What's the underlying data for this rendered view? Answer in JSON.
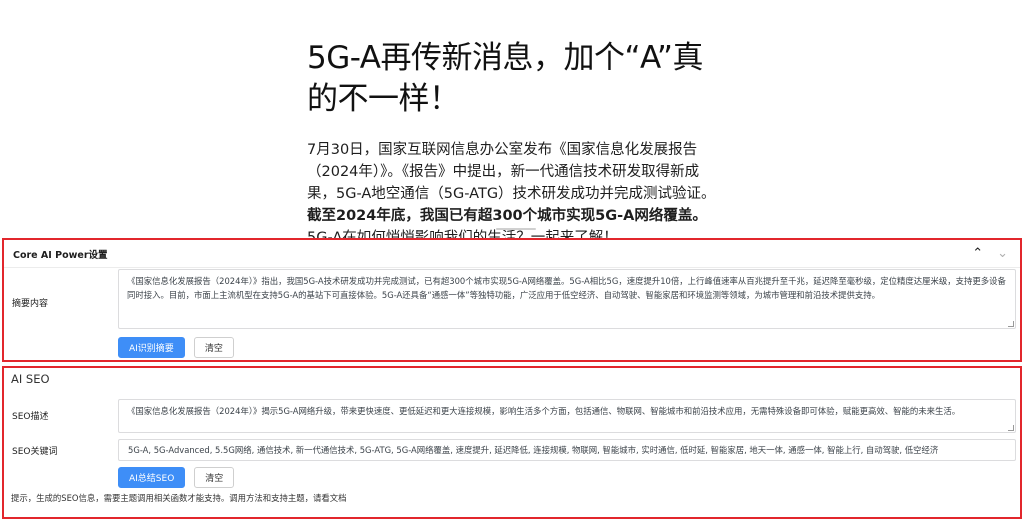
{
  "article": {
    "title": "5G-A再传新消息，加个“A”真的不一样！",
    "lead_normal": "7月30日，国家互联网信息办公室发布《国家信息化发展报告（2024年）》。《报告》中提出，新一代通信技术研发取得新成果，5G-A地空通信（5G-ATG）技术研发成功并完成测试验证。",
    "lead_bold": "截至2024年底，我国已有超300个城市实现5G-A网络覆盖。",
    "lead_tail": "5G-A在如何悄悄影响我们的生活？一起来了解！"
  },
  "core_panel": {
    "title": "Core AI Power设置",
    "summary_label": "摘要内容",
    "summary_text": "《国家信息化发展报告（2024年）》指出，我国5G-A技术研发成功并完成测试，已有超300个城市实现5G-A网络覆盖。5G-A相比5G，速度提升10倍，上行峰值速率从百兆提升至千兆，延迟降至毫秒级，定位精度达厘米级，支持更多设备同时接入。目前，市面上主流机型在支持5G-A的基站下可直接体验。5G-A还具备“通感一体”等独特功能，广泛应用于低空经济、自动驾驶、智能家居和环境监测等领域，为城市管理和前沿技术提供支持。",
    "ai_button": "AI识别摘要",
    "clear_button": "清空"
  },
  "seo_panel": {
    "title": "AI SEO",
    "desc_label": "SEO描述",
    "desc_text": "《国家信息化发展报告（2024年）》揭示5G-A网络升级，带来更快速度、更低延迟和更大连接规模，影响生活多个方面，包括通信、物联网、智能城市和前沿技术应用，无需特殊设备即可体验，赋能更高效、智能的未来生活。",
    "kw_label": "SEO关键词",
    "kw_text": "5G-A, 5G-Advanced, 5.5G网络, 通信技术, 新一代通信技术, 5G-ATG, 5G-A网络覆盖, 速度提升, 延迟降低, 连接规模, 物联网, 智能城市, 实时通信, 低时延, 智能家居, 地天一体, 通感一体, 智能上行, 自动驾驶, 低空经济",
    "ai_button": "AI总结SEO",
    "clear_button": "清空",
    "tip": "提示，生成的SEO信息，需要主题调用相关函数才能支持。调用方法和支持主题，请看文档"
  },
  "icons": {
    "collapse": "chevron-up-icon",
    "expand": "chevron-down-icon"
  },
  "colors": {
    "highlight_border": "#e2262c",
    "primary": "#3e8ef7"
  }
}
